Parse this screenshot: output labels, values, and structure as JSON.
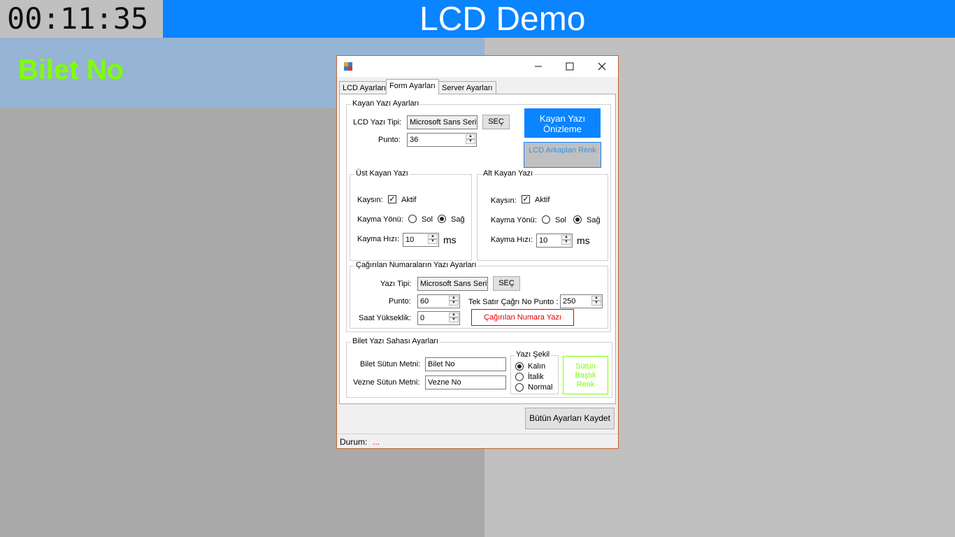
{
  "clock": "00:11:35",
  "header": {
    "title": "LCD Demo"
  },
  "ticket": {
    "label": "Bilet No"
  },
  "dialog": {
    "tabs": [
      "LCD Ayarları",
      "Form Ayarları",
      "Server Ayarları"
    ],
    "kayan": {
      "group_title": "Kayan Yazı Ayarları",
      "font_label": "LCD Yazı Tipi:",
      "font_value": "Microsoft Sans Serif",
      "sec_label": "SEÇ",
      "punto_label": "Punto:",
      "punto_value": "36",
      "preview_button": "Kayan Yazı Önizleme",
      "bg_color_button": "LCD Arkaplan Renk"
    },
    "ust": {
      "group_title": "Üst Kayan Yazı",
      "kaysin_label": "Kaysın:",
      "aktif_label": "Aktif",
      "yon_label": "Kayma Yönü:",
      "sol": "Sol",
      "sag": "Sağ",
      "hiz_label": "Kayma Hızı:",
      "hiz_value": "10",
      "unit": "ms"
    },
    "alt": {
      "group_title": "Alt Kayan Yazı",
      "kaysin_label": "Kaysın:",
      "aktif_label": "Aktif",
      "yon_label": "Kayma Yönü:",
      "sol": "Sol",
      "sag": "Sağ",
      "hiz_label": "Kayma Hızı:",
      "hiz_value": "10",
      "unit": "ms"
    },
    "cagrilan": {
      "group_title": "Çağırılan Numaraların Yazı Ayarları",
      "font_label": "Yazı Tipi:",
      "font_value": "Microsoft Sans Serif",
      "sec_label": "SEÇ",
      "punto_label": "Punto:",
      "punto_value": "60",
      "tek_satir_label": "Tek Satır Çağrı No Punto :",
      "tek_satir_value": "250",
      "saat_label": "Saat Yükseklik:",
      "saat_value": "0",
      "numara_button": "Çağırılan Numara Yazı",
      "numara_color": "#e00000"
    },
    "bilet": {
      "group_title": "Bilet Yazı Sahası Ayarları",
      "bilet_sutun_label": "Bilet Sütun Metni:",
      "bilet_sutun_value": "Bilet No",
      "vezne_sutun_label": "Vezne Sütun Metni:",
      "vezne_sutun_value": "Vezne No",
      "yazi_sekil_title": "Yazı Şekil",
      "kalin": "Kalın",
      "italik": "İtalik",
      "normal": "Normal",
      "sutun_button": "Sütun Başlık Renk",
      "sutun_color": "#7fff00"
    },
    "save_button": "Bütün Ayarları Kaydet",
    "status_label": "Durum:",
    "status_value": "..."
  },
  "colors": {
    "header_bg": "#0a84ff",
    "ticket_text": "#7fff00",
    "preview_btn_bg": "#0a84ff"
  }
}
